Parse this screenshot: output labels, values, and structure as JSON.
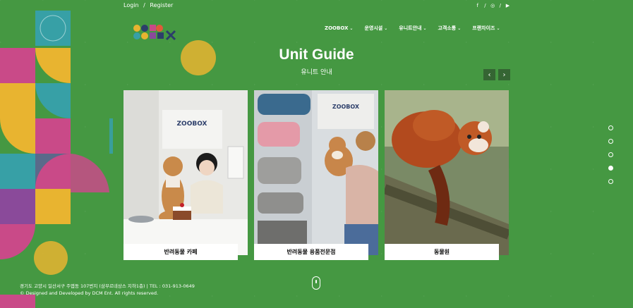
{
  "topbar": {
    "login": "Login",
    "separator": "/",
    "register": "Register",
    "social": [
      {
        "icon": "facebook-icon",
        "glyph": "f"
      },
      {
        "icon": "instagram-icon",
        "glyph": "◎"
      },
      {
        "icon": "youtube-icon",
        "glyph": "▶"
      }
    ]
  },
  "nav": {
    "items": [
      {
        "label": "ZOOBOX"
      },
      {
        "label": "운영시설"
      },
      {
        "label": "유니트안내"
      },
      {
        "label": "고객소통"
      },
      {
        "label": "프랜차이즈"
      }
    ]
  },
  "hero": {
    "title": "Unit Guide",
    "subtitle": "유니트 안내"
  },
  "cards": [
    {
      "label": "반려동물 카페"
    },
    {
      "label": "반려동물 용품전문점"
    },
    {
      "label": "동물원"
    }
  ],
  "slider": {
    "total": 5,
    "active_index": 3
  },
  "footer": {
    "address": "경기도 고양시 일산서구 주엽동 107번지 (삼부르네상스 지하1층) | TEL : 031-913-0649",
    "copyright": "© Designed and Developed by DCM Ent. All rights reserved."
  },
  "colors": {
    "background": "#4c9a45",
    "accent": "#ffffff"
  }
}
